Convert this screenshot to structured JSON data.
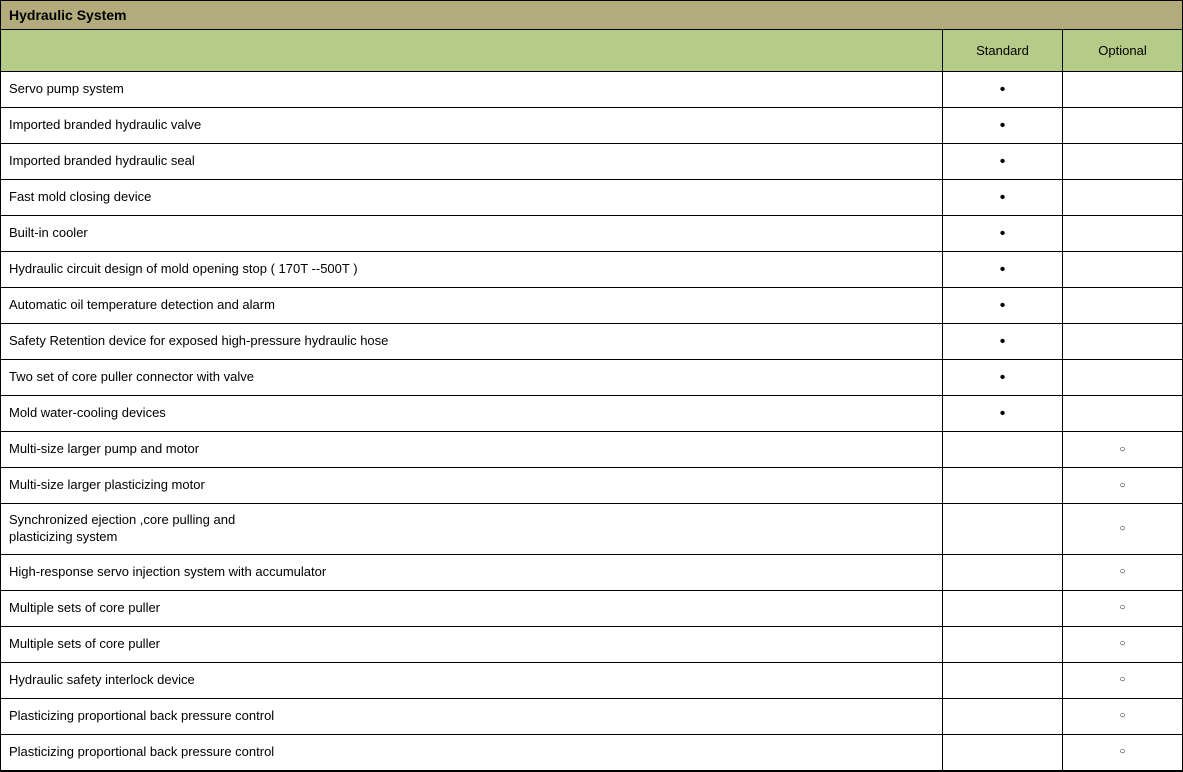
{
  "title": "Hydraulic System",
  "columns": {
    "standard": "Standard",
    "optional": "Optional"
  },
  "symbols": {
    "standard": "•",
    "optional": "○"
  },
  "rows": [
    {
      "feature": "Servo pump system",
      "standard": true,
      "optional": false
    },
    {
      "feature": "Imported branded hydraulic valve",
      "standard": true,
      "optional": false
    },
    {
      "feature": "Imported branded hydraulic seal",
      "standard": true,
      "optional": false
    },
    {
      "feature": "Fast mold closing device",
      "standard": true,
      "optional": false
    },
    {
      "feature": "Built-in cooler",
      "standard": true,
      "optional": false
    },
    {
      "feature": "Hydraulic circuit design of mold opening stop ( 170T --500T )",
      "standard": true,
      "optional": false
    },
    {
      "feature": "Automatic oil  temperature detection and alarm",
      "standard": true,
      "optional": false
    },
    {
      "feature": "Safety Retention device  for exposed high-pressure hydraulic hose",
      "standard": true,
      "optional": false
    },
    {
      "feature": "Two set of core puller connector with valve",
      "standard": true,
      "optional": false
    },
    {
      "feature": "Mold water-cooling devices",
      "standard": true,
      "optional": false
    },
    {
      "feature": "Multi-size larger pump and motor",
      "standard": false,
      "optional": true
    },
    {
      "feature": "Multi-size larger plasticizing motor",
      "standard": false,
      "optional": true
    },
    {
      "feature": "Synchronized ejection ,core pulling and\nplasticizing system",
      "standard": false,
      "optional": true
    },
    {
      "feature": "High-response servo injection system with accumulator",
      "standard": false,
      "optional": true
    },
    {
      "feature": "Multiple sets of core puller",
      "standard": false,
      "optional": true
    },
    {
      "feature": "Multiple sets of core puller",
      "standard": false,
      "optional": true
    },
    {
      "feature": "Hydraulic safety interlock device",
      "standard": false,
      "optional": true
    },
    {
      "feature": "Plasticizing proportional back pressure control",
      "standard": false,
      "optional": true
    },
    {
      "feature": "Plasticizing proportional back pressure control",
      "standard": false,
      "optional": true
    }
  ]
}
